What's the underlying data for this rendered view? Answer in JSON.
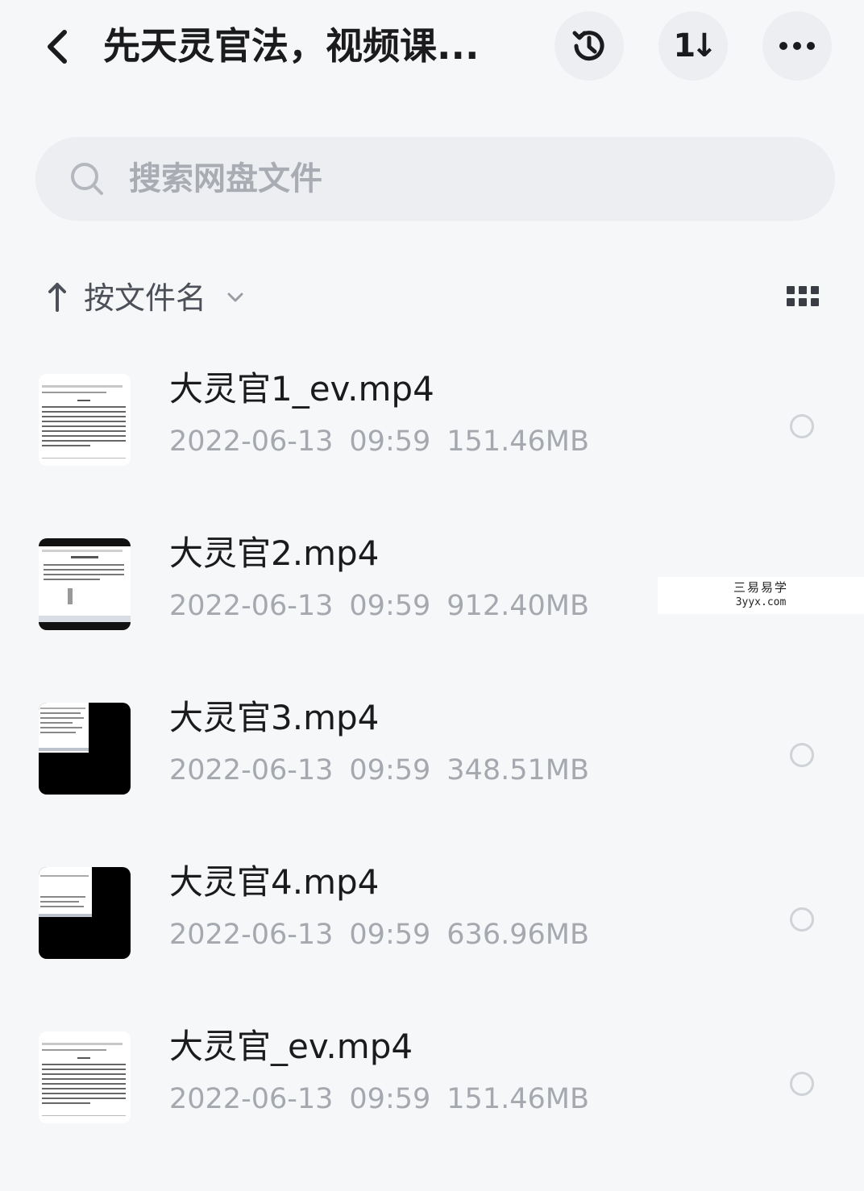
{
  "header": {
    "back_icon": "chevron-left-icon",
    "title": "先天灵官法，视频课...",
    "history_icon": "history-clock-icon",
    "sort_icon": "sort-order-icon",
    "sort_glyph": "1↓",
    "more_icon": "more-dots-icon"
  },
  "search": {
    "icon": "search-icon",
    "placeholder": "搜索网盘文件"
  },
  "sort": {
    "direction_icon": "arrow-up-icon",
    "label": "按文件名",
    "dropdown_icon": "chevron-down-icon",
    "view_icon": "grid-view-icon"
  },
  "files": [
    {
      "name": "大灵官1_ev.mp4",
      "date": "2022-06-13",
      "time": "09:59",
      "size": "151.46MB",
      "thumb": "document"
    },
    {
      "name": "大灵官2.mp4",
      "date": "2022-06-13",
      "time": "09:59",
      "size": "912.40MB",
      "thumb": "screen"
    },
    {
      "name": "大灵官3.mp4",
      "date": "2022-06-13",
      "time": "09:59",
      "size": "348.51MB",
      "thumb": "dark"
    },
    {
      "name": "大灵官4.mp4",
      "date": "2022-06-13",
      "time": "09:59",
      "size": "636.96MB",
      "thumb": "dark"
    },
    {
      "name": "大灵官_ev.mp4",
      "date": "2022-06-13",
      "time": "09:59",
      "size": "151.46MB",
      "thumb": "document"
    }
  ],
  "watermark": {
    "line1": "三易易学",
    "line2": "3yyx.com"
  },
  "colors": {
    "background": "#f6f7f9",
    "button_bg": "#eceef1",
    "text_primary": "#1b1b1d",
    "text_secondary": "#a5a8ae"
  }
}
